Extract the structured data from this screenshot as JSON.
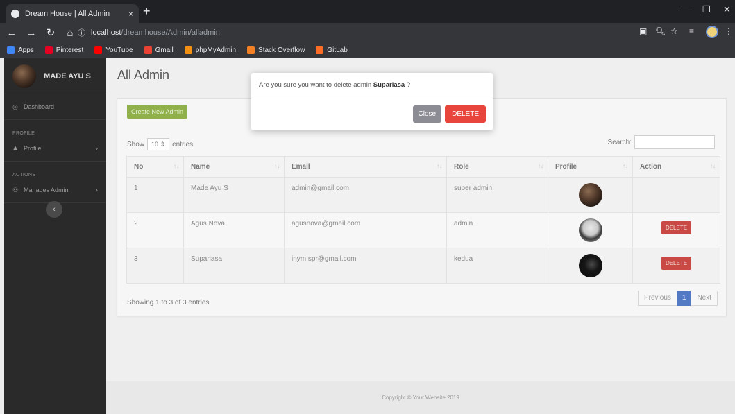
{
  "browser": {
    "tab_title": "Dream House | All Admin",
    "tab_close": "×",
    "new_tab": "+",
    "url_host": "localhost",
    "url_path": "/dreamhouse/Admin/alladmin",
    "bookmarks": [
      {
        "label": "Apps",
        "icon": "apps-icon",
        "color": "#4285f4"
      },
      {
        "label": "Pinterest",
        "icon": "pinterest-icon",
        "color": "#e60023"
      },
      {
        "label": "YouTube",
        "icon": "youtube-icon",
        "color": "#ff0000"
      },
      {
        "label": "Gmail",
        "icon": "gmail-icon",
        "color": "#ea4335"
      },
      {
        "label": "phpMyAdmin",
        "icon": "phpmyadmin-icon",
        "color": "#f29111"
      },
      {
        "label": "Stack Overflow",
        "icon": "stackoverflow-icon",
        "color": "#f48024"
      },
      {
        "label": "GitLab",
        "icon": "gitlab-icon",
        "color": "#fc6d26"
      }
    ]
  },
  "sidebar": {
    "user_name": "MADE AYU S",
    "dashboard": "Dashboard",
    "profile_heading": "PROFILE",
    "profile": "Profile",
    "actions_heading": "ACTIONS",
    "manages_admin": "Manages Admin"
  },
  "main": {
    "title": "All Admin",
    "create_button": "Create New Admin",
    "show_label": "Show",
    "entries_value": "10",
    "entries_label": "entries",
    "search_label": "Search:",
    "columns": [
      "No",
      "Name",
      "Email",
      "Role",
      "Profile",
      "Action"
    ],
    "rows": [
      {
        "no": "1",
        "name": "Made Ayu S",
        "email": "admin@gmail.com",
        "role": "super admin",
        "action": ""
      },
      {
        "no": "2",
        "name": "Agus Nova",
        "email": "agusnova@gmail.com",
        "role": "admin",
        "action": "DELETE"
      },
      {
        "no": "3",
        "name": "Supariasa",
        "email": "inym.spr@gmail.com",
        "role": "kedua",
        "action": "DELETE"
      }
    ],
    "info": "Showing 1 to 3 of 3 entries",
    "pager_previous": "Previous",
    "pager_page": "1",
    "pager_next": "Next"
  },
  "footer": "Copyright © Your Website 2019",
  "modal": {
    "message_prefix": "Are you sure you want to delete admin ",
    "admin_name": "Supariasa",
    "message_suffix": " ?",
    "close_label": "Close",
    "delete_label": "DELETE"
  }
}
